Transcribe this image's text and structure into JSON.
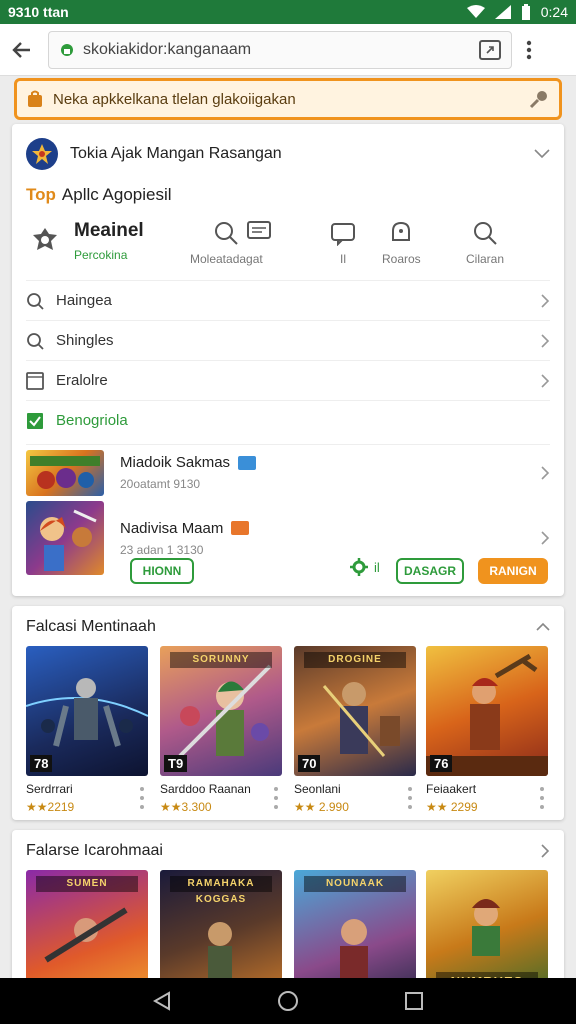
{
  "status_bar": {
    "left_time": "9310 ttan",
    "right_time": "0:24"
  },
  "url_bar": {
    "url": "skokiakidor:kanganaam"
  },
  "notice": {
    "text": "Neka apkkelkana tlelan glakoiigakan"
  },
  "store": {
    "name": "Tokia Ajak Mangan Rasangan"
  },
  "top_apps": {
    "prefix": "Top",
    "title": "Apllc Agopiesil"
  },
  "quick_actions": {
    "main_title": "Meainel",
    "main_sub": "Percokina",
    "items": [
      {
        "label": "Moleatadagat",
        "icon": "search-icon"
      },
      {
        "label": "Il",
        "icon": "chat-icon"
      },
      {
        "label": "Roaros",
        "icon": "bell-icon"
      },
      {
        "label": "Cilaran",
        "icon": "search-icon"
      }
    ]
  },
  "menu": [
    {
      "label": "Haingea",
      "icon": "search-icon"
    },
    {
      "label": "Shingles",
      "icon": "search-icon"
    },
    {
      "label": "Eralolre",
      "icon": "square-icon"
    },
    {
      "label": "Benogriola",
      "icon": "check-square-icon"
    }
  ],
  "games": [
    {
      "name": "Miadoik Sakmas",
      "meta": "20oatamt 9130",
      "badge_color": "#3a8fd8"
    },
    {
      "name": "Nadivisa Maam",
      "meta": "23 adan 1 3130",
      "badge_color": "#e8762b"
    }
  ],
  "buttons": {
    "left": "HIONN",
    "stat": "il",
    "mid": "DASAGR",
    "right": "RANIGN"
  },
  "featured": {
    "title": "Falcasi Mentinaah",
    "items": [
      {
        "name": "Serdrrari",
        "rating": "★★2219",
        "badge": "78",
        "banner": ""
      },
      {
        "name": "Sarddoo Raanan",
        "rating": "★★3.300",
        "badge": "T9",
        "banner": "SORUNNY"
      },
      {
        "name": "Seonlani",
        "rating": "★★ 2.990",
        "badge": "70",
        "banner": "DROGINE"
      },
      {
        "name": "Feiaakert",
        "rating": "★★ 2299",
        "badge": "76",
        "banner": ""
      }
    ]
  },
  "second_section": {
    "title": "Falarse Icarohmaai",
    "items": [
      {
        "banner": "SUMEN"
      },
      {
        "banner": "RAMAHAKA KOGGAS"
      },
      {
        "banner": "NOUNAAK"
      },
      {
        "banner": "NUMRUES"
      }
    ]
  },
  "colors": {
    "accent_green": "#2e9b3b",
    "accent_orange": "#f0931e",
    "status_green": "#1f7a3a"
  }
}
